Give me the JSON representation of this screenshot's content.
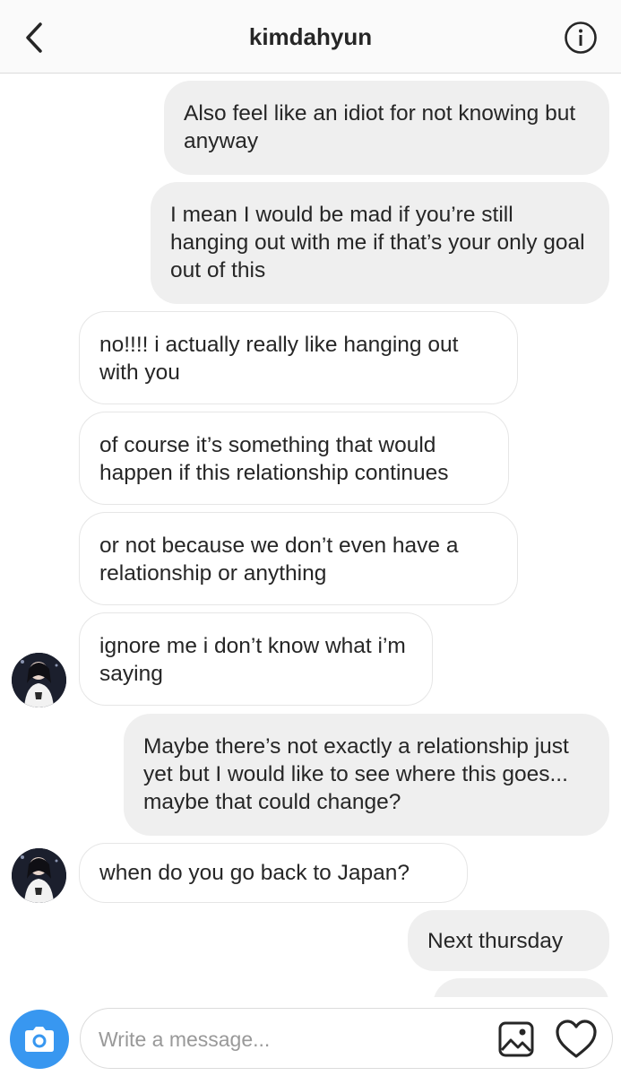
{
  "header": {
    "title": "kimdahyun",
    "back_icon": "chevron-left-icon",
    "info_icon": "info-icon"
  },
  "messages": [
    {
      "direction": "outgoing",
      "text": "Also feel like an idiot for not knowing but anyway"
    },
    {
      "direction": "outgoing",
      "text": "I mean I would be mad if you’re still hanging out with me if that’s your only goal out of this"
    },
    {
      "direction": "incoming",
      "text": "no!!!! i actually really like hanging out with you"
    },
    {
      "direction": "incoming",
      "text": "of course it’s something that would happen if this relationship continues"
    },
    {
      "direction": "incoming",
      "text": "or not because we don’t even have a relationship or anything"
    },
    {
      "direction": "incoming",
      "text": "ignore me i don’t know what i’m saying",
      "show_avatar": true
    },
    {
      "direction": "outgoing",
      "text": "Maybe there’s not exactly a relationship just yet but I would like to see where this goes... maybe that could change?"
    },
    {
      "direction": "incoming",
      "text": "when do you go back to Japan?",
      "show_avatar": true
    },
    {
      "direction": "outgoing",
      "text": "Next thursday"
    },
    {
      "direction": "outgoing",
      "text": ""
    }
  ],
  "composer": {
    "placeholder": "Write a message...",
    "value": "",
    "camera_icon": "camera-icon",
    "gallery_icon": "image-gallery-icon",
    "like_icon": "heart-icon"
  },
  "colors": {
    "accent": "#3897f0",
    "outgoing_bubble": "#efefef",
    "incoming_border": "#e6e6e6",
    "text": "#262626",
    "placeholder": "#999999"
  }
}
